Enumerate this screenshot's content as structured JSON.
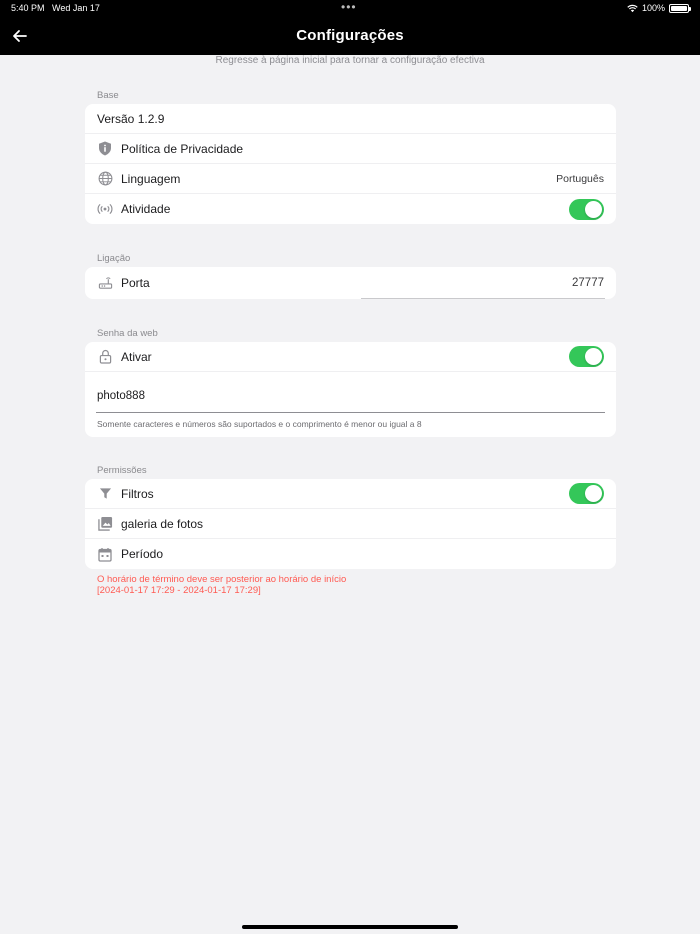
{
  "status": {
    "time": "5:40 PM",
    "date": "Wed Jan 17",
    "battery": "100%"
  },
  "header": {
    "title": "Configurações"
  },
  "hint": "Regresse à página inicial para tornar a configuração efectiva",
  "base": {
    "label": "Base",
    "version": "Versão 1.2.9",
    "privacy": "Política de Privacidade",
    "language_label": "Linguagem",
    "language_value": "Português",
    "activity_label": "Atividade",
    "activity_on": true
  },
  "connection": {
    "label": "Ligação",
    "port_label": "Porta",
    "port_value": "27777"
  },
  "web_password": {
    "label": "Senha da web",
    "enable_label": "Ativar",
    "enable_on": true,
    "password": "photo888",
    "helper": "Somente caracteres e números são suportados e o comprimento é menor ou igual a 8"
  },
  "permissions": {
    "label": "Permissões",
    "filters_label": "Filtros",
    "filters_on": true,
    "gallery_label": "galeria de fotos",
    "period_label": "Período"
  },
  "error": {
    "line1": "O horário de término deve ser posterior ao horário de início",
    "line2": "[2024-01-17 17:29 - 2024-01-17 17:29]"
  },
  "colors": {
    "accent": "#34c759",
    "error": "#ff5a52",
    "header_bg": "#000000",
    "page_bg": "#f2f2f4"
  }
}
